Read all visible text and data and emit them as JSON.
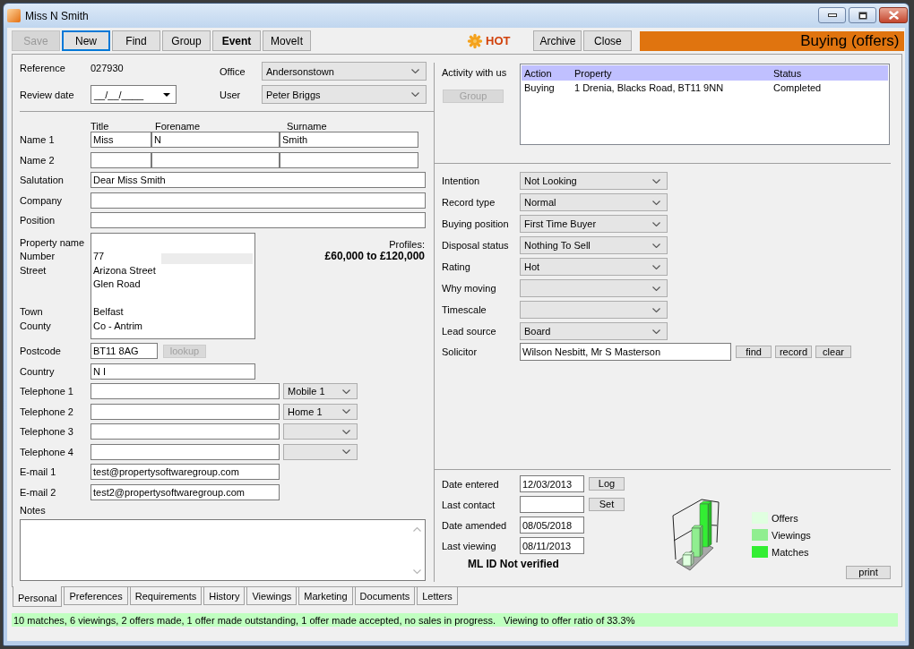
{
  "window": {
    "title": "Miss N Smith"
  },
  "toolbar": [
    {
      "label": "Save",
      "disabled": true,
      "focused": false,
      "bold": false
    },
    {
      "label": "New",
      "disabled": false,
      "focused": true,
      "bold": false
    },
    {
      "label": "Find",
      "disabled": false,
      "focused": false,
      "bold": false
    },
    {
      "label": "Group",
      "disabled": false,
      "focused": false,
      "bold": false
    },
    {
      "label": "Event",
      "disabled": false,
      "focused": false,
      "bold": true
    },
    {
      "label": "MoveIt",
      "disabled": false,
      "focused": false,
      "bold": false
    }
  ],
  "rating": {
    "label": "HOT"
  },
  "record_buttons": [
    {
      "label": "Archive"
    },
    {
      "label": "Close"
    }
  ],
  "stage_banner": {
    "label": "Buying (offers)"
  },
  "personal": {
    "reference": {
      "label": "Reference",
      "value": "027930"
    },
    "review_date": {
      "label": "Review date",
      "value": "__/__/____"
    },
    "office": {
      "label": "Office",
      "value": "Andersonstown"
    },
    "user": {
      "label": "User",
      "value": "Peter Briggs"
    },
    "name_columns": [
      "Title",
      "Forename",
      "Surname"
    ],
    "names": [
      {
        "label": "Name 1",
        "values": [
          "Miss",
          "N",
          "Smith"
        ]
      },
      {
        "label": "Name 2"
      }
    ],
    "fields": [
      {
        "label": "Salutation",
        "value": "Dear Miss Smith"
      },
      {
        "label": "Company"
      },
      {
        "label": "Position"
      }
    ],
    "address": [
      {
        "kind": "line",
        "label": "Property name"
      },
      {
        "kind": "line",
        "label": "Number",
        "value": "77"
      },
      {
        "kind": "line",
        "label": "Street",
        "value": "Arizona Street"
      },
      {
        "kind": "line",
        "value": "Glen Road"
      },
      {
        "kind": "blank"
      },
      {
        "kind": "line",
        "label": "Town",
        "value": "Belfast"
      },
      {
        "kind": "line",
        "label": "County",
        "value": "Co - Antrim"
      }
    ],
    "profiles": {
      "label": "Profiles:",
      "value": "£60,000 to £120,000"
    },
    "postcode": {
      "label": "Postcode",
      "value": "BT11 8AG",
      "lookup": {
        "label": "lookup",
        "disabled": true
      }
    },
    "country": {
      "label": "Country",
      "value": "N I"
    },
    "telephones": [
      {
        "label": "Telephone 1",
        "type": "Mobile 1"
      },
      {
        "label": "Telephone 2",
        "type": "Home 1"
      },
      {
        "label": "Telephone 3"
      },
      {
        "label": "Telephone 4"
      }
    ],
    "emails": [
      {
        "label": "E-mail 1",
        "value": "test@propertysoftwaregroup.com"
      },
      {
        "label": "E-mail 2",
        "value": "test2@propertysoftwaregroup.com"
      }
    ],
    "notes": {
      "label": "Notes"
    }
  },
  "activity": {
    "label": "Activity with us",
    "group_button": {
      "label": "Group",
      "disabled": true
    },
    "columns": [
      "Action",
      "Property",
      "Status"
    ],
    "rows": [
      [
        "Buying",
        "1 Drenia, Blacks Road, BT11 9NN",
        "Completed"
      ]
    ]
  },
  "preferences": [
    {
      "label": "Intention",
      "value": "Not Looking"
    },
    {
      "label": "Record type",
      "value": "Normal"
    },
    {
      "label": "Buying position",
      "value": "First Time Buyer"
    },
    {
      "label": "Disposal status",
      "value": "Nothing To Sell"
    },
    {
      "label": "Rating",
      "value": "Hot"
    },
    {
      "label": "Why moving"
    },
    {
      "label": "Timescale"
    },
    {
      "label": "Lead source",
      "value": "Board"
    }
  ],
  "solicitor": {
    "label": "Solicitor",
    "value": "Wilson Nesbitt, Mr S Masterson",
    "buttons": [
      "find",
      "record",
      "clear"
    ]
  },
  "dates": [
    {
      "label": "Date entered",
      "value": "12/03/2013",
      "button": "Log"
    },
    {
      "label": "Last contact",
      "button": "Set"
    },
    {
      "label": "Date amended",
      "value": "08/05/2018"
    },
    {
      "label": "Last viewing",
      "value": "08/11/2013"
    }
  ],
  "verification": {
    "text": "ML ID Not verified"
  },
  "chart_legend": [
    {
      "label": "Offers",
      "color": "#e0ffe0"
    },
    {
      "label": "Viewings",
      "color": "#90ee90"
    },
    {
      "label": "Matches",
      "color": "#33ee33"
    }
  ],
  "print_button": {
    "label": "print"
  },
  "tabs": [
    {
      "label": "Personal",
      "selected": true
    },
    {
      "label": "Preferences",
      "selected": false
    },
    {
      "label": "Requirements",
      "selected": false
    },
    {
      "label": "History",
      "selected": false
    },
    {
      "label": "Viewings",
      "selected": false
    },
    {
      "label": "Marketing",
      "selected": false
    },
    {
      "label": "Documents",
      "selected": false
    },
    {
      "label": "Letters",
      "selected": false
    }
  ],
  "status_bar": {
    "summary": "10 matches, 6 viewings, 2 offers made, 1 offer made outstanding, 1 offer made accepted, no sales in progress.",
    "ratio": "Viewing to offer ratio of 33.3%"
  }
}
